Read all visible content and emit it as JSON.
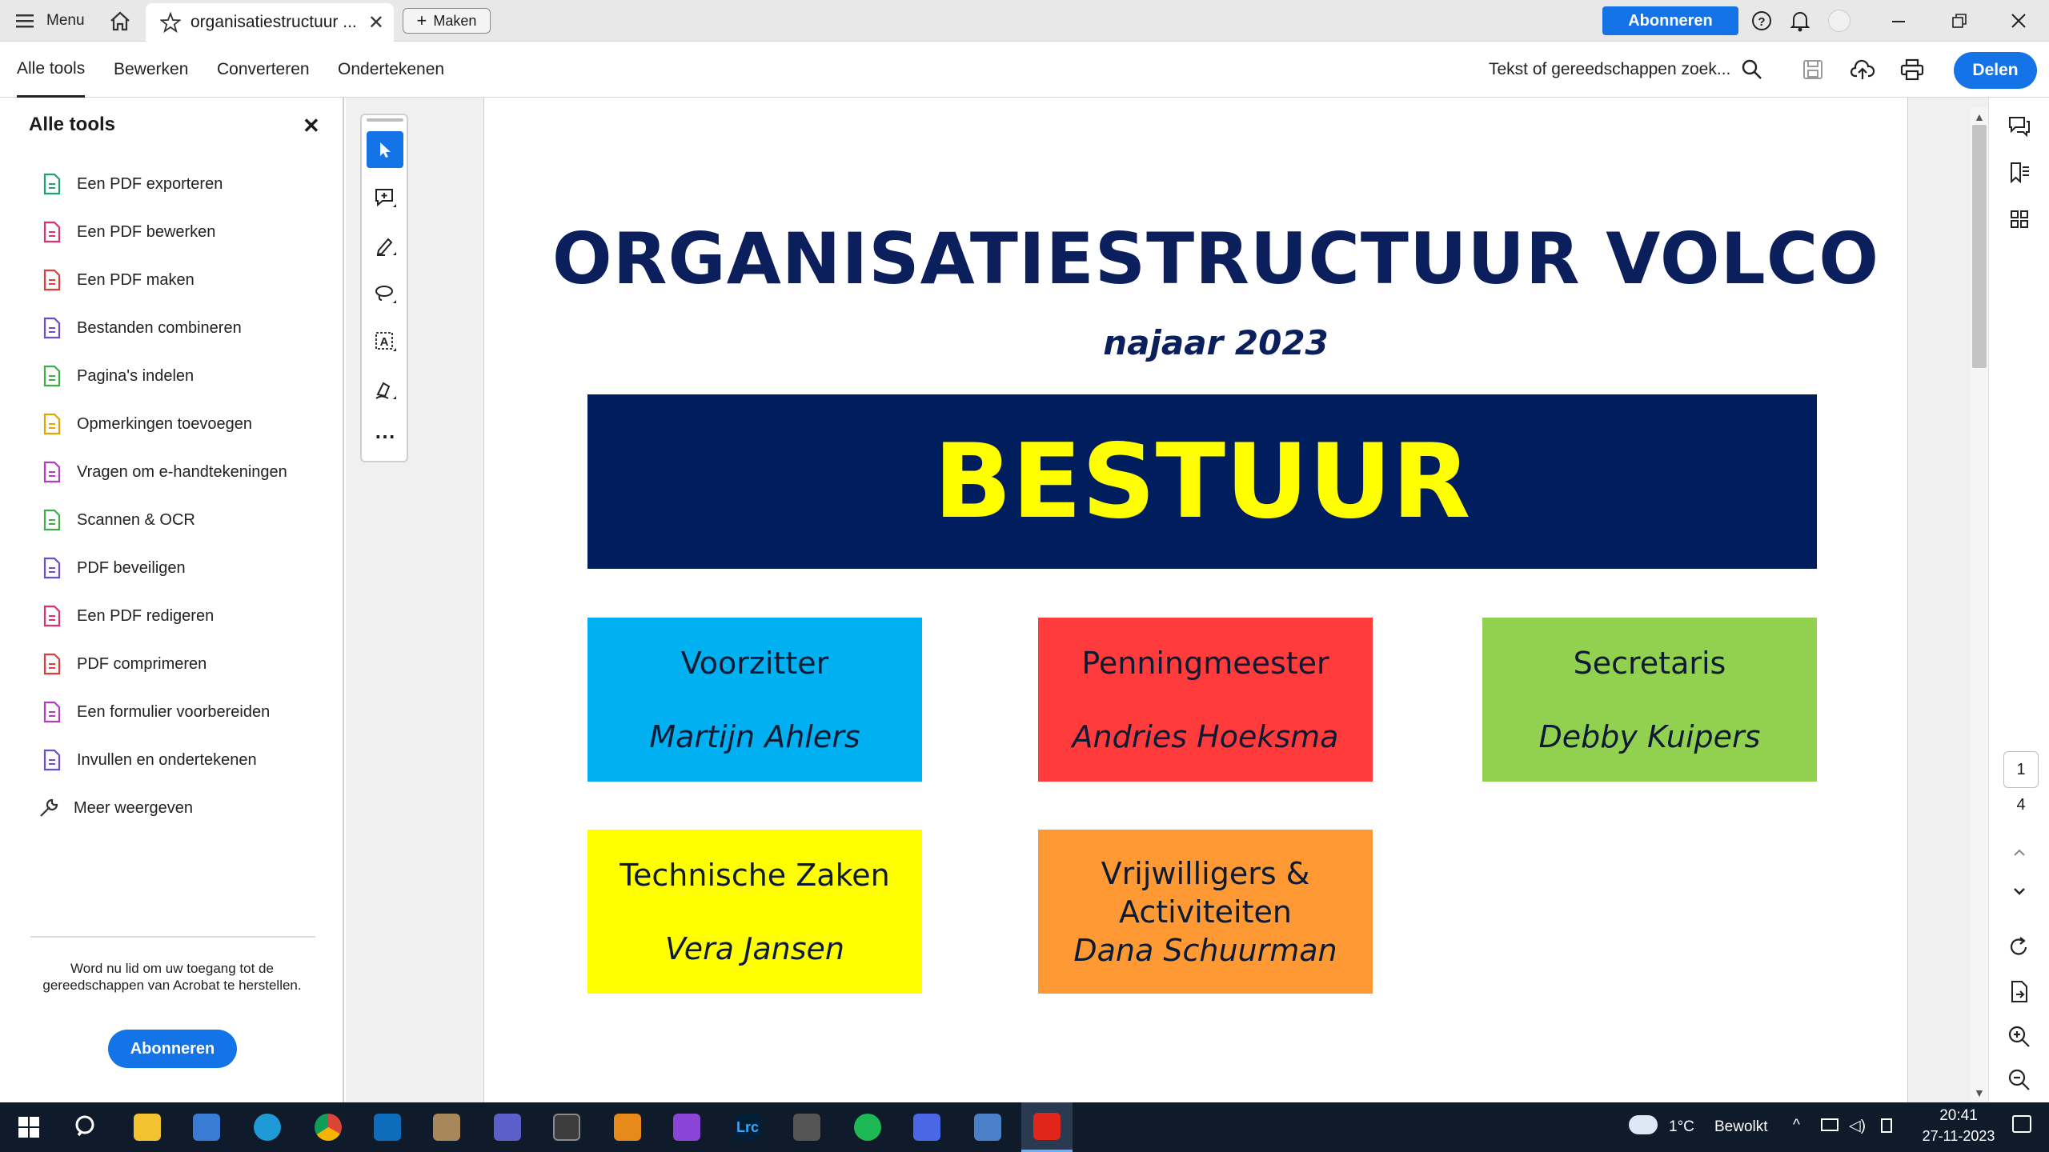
{
  "titlebar": {
    "menu_label": "Menu",
    "tab_title": "organisatiestructuur ...",
    "maken_label": "Maken",
    "subscribe_label": "Abonneren"
  },
  "menubar": {
    "tabs": [
      "Alle tools",
      "Bewerken",
      "Converteren",
      "Ondertekenen"
    ],
    "search_placeholder": "Tekst of gereedschappen zoek...",
    "share_label": "Delen"
  },
  "sidebar": {
    "title": "Alle tools",
    "items": [
      {
        "label": "Een PDF exporteren",
        "icon": "export-pdf-icon",
        "color": "#1aa37a"
      },
      {
        "label": "Een PDF bewerken",
        "icon": "edit-pdf-icon",
        "color": "#e0306a"
      },
      {
        "label": "Een PDF maken",
        "icon": "create-pdf-icon",
        "color": "#e03b3b"
      },
      {
        "label": "Bestanden combineren",
        "icon": "combine-files-icon",
        "color": "#6c4bd6"
      },
      {
        "label": "Pagina's indelen",
        "icon": "organize-pages-icon",
        "color": "#3fae49"
      },
      {
        "label": "Opmerkingen toevoegen",
        "icon": "comment-icon",
        "color": "#e6a400"
      },
      {
        "label": "Vragen om e-handtekeningen",
        "icon": "request-signature-icon",
        "color": "#b53bc2"
      },
      {
        "label": "Scannen & OCR",
        "icon": "scan-ocr-icon",
        "color": "#3fae49"
      },
      {
        "label": "PDF beveiligen",
        "icon": "protect-pdf-icon",
        "color": "#6c4bd6"
      },
      {
        "label": "Een PDF redigeren",
        "icon": "redact-pdf-icon",
        "color": "#e0306a"
      },
      {
        "label": "PDF comprimeren",
        "icon": "compress-pdf-icon",
        "color": "#e03b3b"
      },
      {
        "label": "Een formulier voorbereiden",
        "icon": "prepare-form-icon",
        "color": "#b53bc2"
      },
      {
        "label": "Invullen en ondertekenen",
        "icon": "fill-sign-icon",
        "color": "#6c4bd6"
      }
    ],
    "more_label": "Meer weergeven",
    "promo_text": "Word nu lid om uw toegang tot de gereedschappen van Acrobat te herstellen.",
    "promo_button": "Abonneren"
  },
  "document": {
    "title": "ORGANISATIESTRUCTUUR VOLCO",
    "subtitle": "najaar 2023",
    "banner": "BESTUUR",
    "boxes": [
      {
        "role": "Voorzitter",
        "person": "Martijn Ahlers",
        "color": "#00b0f0"
      },
      {
        "role": "Penningmeester",
        "person": "Andries Hoeksma",
        "color": "#ff3b3b"
      },
      {
        "role": "Secretaris",
        "person": "Debby Kuipers",
        "color": "#92d050"
      },
      {
        "role": "Technische Zaken",
        "person": "Vera Jansen",
        "color": "#ffff00"
      },
      {
        "role": "Vrijwilligers & Activiteiten",
        "person": "Dana Schuurman",
        "color": "#ff9933"
      }
    ]
  },
  "pagenav": {
    "current": "1",
    "total": "4"
  },
  "taskbar": {
    "weather_temp": "1°C",
    "weather_text": "Bewolkt",
    "time": "20:41",
    "date": "27-11-2023"
  }
}
